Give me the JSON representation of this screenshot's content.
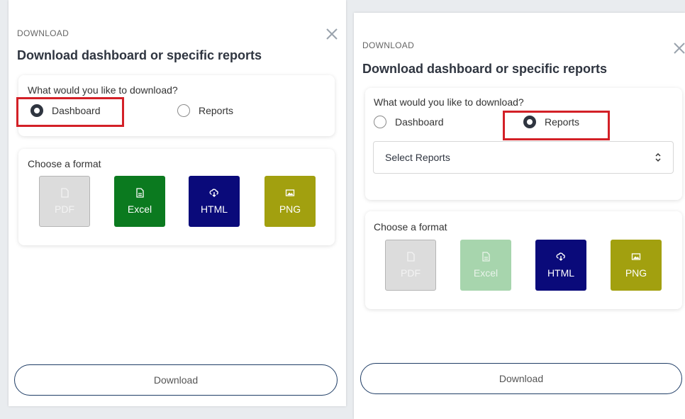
{
  "panels": [
    {
      "eyebrow": "DOWNLOAD",
      "title": "Download dashboard or specific reports",
      "question": "What would you like to download?",
      "option_dashboard": "Dashboard",
      "option_reports": "Reports",
      "selected": "Dashboard",
      "format_label": "Choose a format",
      "formats": [
        "PDF",
        "Excel",
        "HTML",
        "PNG"
      ],
      "download_label": "Download"
    },
    {
      "eyebrow": "DOWNLOAD",
      "title": "Download dashboard or specific reports",
      "question": "What would you like to download?",
      "option_dashboard": "Dashboard",
      "option_reports": "Reports",
      "selected": "Reports",
      "select_placeholder": "Select Reports",
      "format_label": "Choose a format",
      "formats": [
        "PDF",
        "Excel",
        "HTML",
        "PNG"
      ],
      "download_label": "Download"
    }
  ],
  "colors": {
    "highlight": "#d32027",
    "excel": "#0b7a1f",
    "html": "#0a0a7a",
    "png": "#a2a00f",
    "disabled": "#dcdcdc"
  },
  "icons": [
    "close-icon",
    "file-icon",
    "spreadsheet-icon",
    "cloud-download-icon",
    "image-icon",
    "sort-arrows-icon"
  ]
}
